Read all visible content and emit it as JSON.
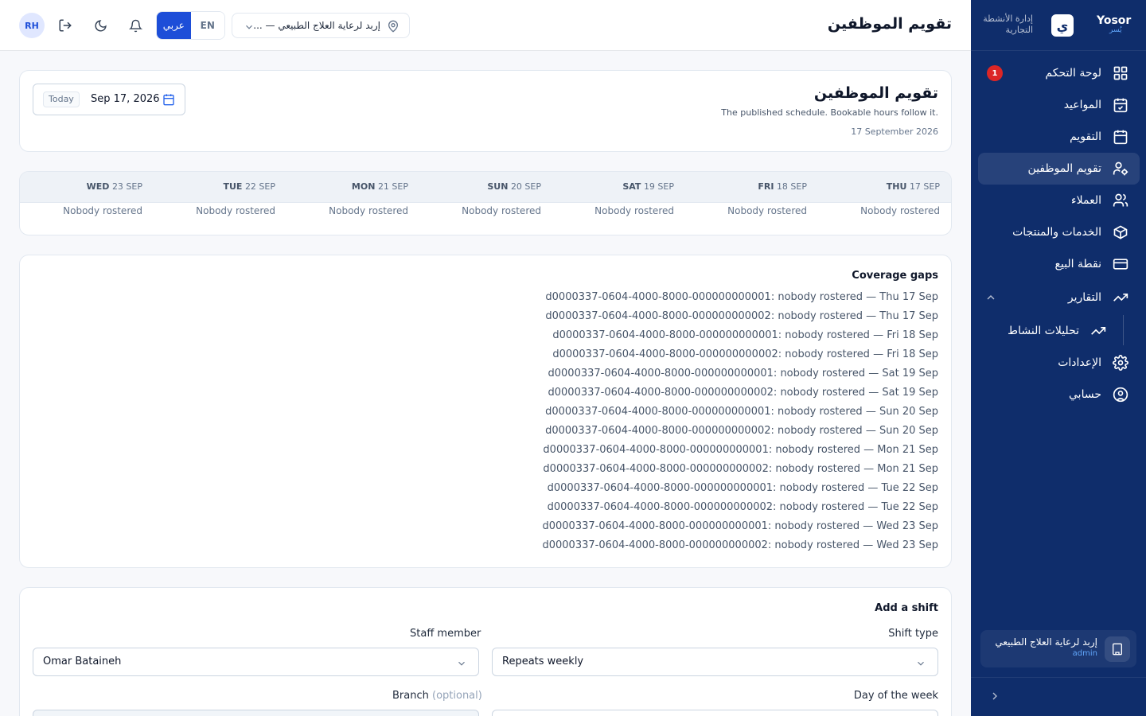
{
  "sidebar": {
    "brand": {
      "name": "Yosor",
      "name_ar": "يُسر",
      "logo_letter": "ي",
      "subtitle": "إدارة الأنشطة التجارية"
    },
    "items": [
      {
        "label": "لوحة التحكم",
        "icon": "dashboard-icon",
        "badge": "1"
      },
      {
        "label": "المواعيد",
        "icon": "calendar-check-icon"
      },
      {
        "label": "التقويم",
        "icon": "calendar-icon"
      },
      {
        "label": "تقويم الموظفين",
        "icon": "user-cog-icon",
        "active": true
      },
      {
        "label": "العملاء",
        "icon": "users-icon"
      },
      {
        "label": "الخدمات والمنتجات",
        "icon": "package-icon"
      },
      {
        "label": "نقطة البيع",
        "icon": "credit-card-icon"
      },
      {
        "label": "التقارير",
        "icon": "trending-up-icon"
      },
      {
        "label": "تحليلات النشاط",
        "icon": "trending-up-icon"
      },
      {
        "label": "الإعدادات",
        "icon": "settings-icon"
      },
      {
        "label": "حسابي",
        "icon": "user-circle-icon"
      }
    ],
    "org": {
      "name": "إربد لرعاية العلاج الطبيعي",
      "role": "admin"
    }
  },
  "header": {
    "title": "تقويم الموظفين",
    "avatar": "RH",
    "lang": {
      "en": "EN",
      "ar": "عربي"
    },
    "branch": "إربد لرعاية العلاج الطبيعي — ..."
  },
  "summary": {
    "title": "تقويم الموظفين",
    "subtitle": "The published schedule. Bookable hours follow it.",
    "date_text": "17 September 2026",
    "picker_value": "Sep 17, 2026",
    "today": "Today"
  },
  "week": {
    "empty_text": "Nobody rostered",
    "days": [
      {
        "dow": "THU",
        "date": "17 SEP"
      },
      {
        "dow": "FRI",
        "date": "18 SEP"
      },
      {
        "dow": "SAT",
        "date": "19 SEP"
      },
      {
        "dow": "SUN",
        "date": "20 SEP"
      },
      {
        "dow": "MON",
        "date": "21 SEP"
      },
      {
        "dow": "TUE",
        "date": "22 SEP"
      },
      {
        "dow": "WED",
        "date": "23 SEP"
      }
    ]
  },
  "coverage": {
    "title": "Coverage gaps",
    "lines": [
      "d0000337-0604-4000-8000-000000000001: nobody rostered — Thu 17 Sep",
      "d0000337-0604-4000-8000-000000000002: nobody rostered — Thu 17 Sep",
      "d0000337-0604-4000-8000-000000000001: nobody rostered — Fri 18 Sep",
      "d0000337-0604-4000-8000-000000000002: nobody rostered — Fri 18 Sep",
      "d0000337-0604-4000-8000-000000000001: nobody rostered — Sat 19 Sep",
      "d0000337-0604-4000-8000-000000000002: nobody rostered — Sat 19 Sep",
      "d0000337-0604-4000-8000-000000000001: nobody rostered — Sun 20 Sep",
      "d0000337-0604-4000-8000-000000000002: nobody rostered — Sun 20 Sep",
      "d0000337-0604-4000-8000-000000000001: nobody rostered — Mon 21 Sep",
      "d0000337-0604-4000-8000-000000000002: nobody rostered — Mon 21 Sep",
      "d0000337-0604-4000-8000-000000000001: nobody rostered — Tue 22 Sep",
      "d0000337-0604-4000-8000-000000000002: nobody rostered — Tue 22 Sep",
      "d0000337-0604-4000-8000-000000000001: nobody rostered — Wed 23 Sep",
      "d0000337-0604-4000-8000-000000000002: nobody rostered — Wed 23 Sep"
    ]
  },
  "add_shift": {
    "title": "Add a shift",
    "staff_label": "Staff member",
    "staff_value": "Omar Bataineh",
    "type_label": "Shift type",
    "type_value": "Repeats weekly",
    "branch_label": "Branch",
    "branch_optional": "(optional)",
    "dow_label": "Day of the week"
  }
}
